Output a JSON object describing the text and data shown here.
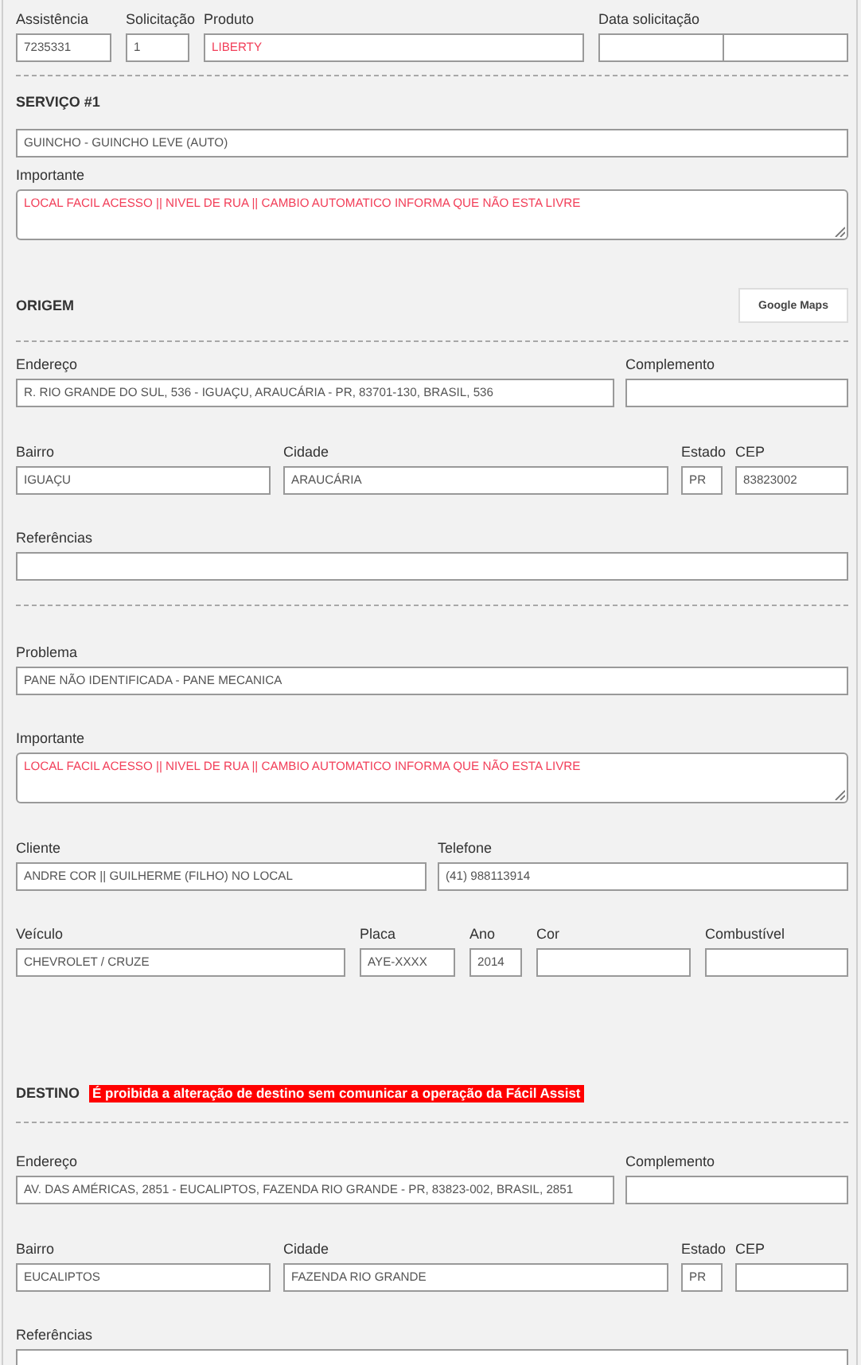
{
  "blocks": [
    {
      "kind": "row",
      "fields": [
        {
          "kind": "text",
          "label": "Assistência",
          "value": "7235331",
          "warning": false
        },
        {
          "kind": "text",
          "label": "Solicitação",
          "value": "1",
          "warning": false
        },
        {
          "kind": "text",
          "label": "Produto",
          "value": "LIBERTY",
          "warning": true
        },
        {
          "kind": "split",
          "label": "Data solicitação"
        }
      ]
    },
    {
      "kind": "divider"
    },
    {
      "kind": "heading",
      "title": "SERVIÇO #1"
    },
    {
      "kind": "row",
      "fields": [
        {
          "kind": "text",
          "value": "GUINCHO - GUINCHO LEVE (AUTO)",
          "warning": false
        }
      ]
    },
    {
      "kind": "row",
      "fields": [
        {
          "kind": "textarea",
          "label": "Importante",
          "value": "LOCAL FACIL ACESSO || NIVEL DE RUA || CAMBIO AUTOMATICO INFORMA QUE NÃO ESTA LIVRE",
          "warning": true
        }
      ]
    },
    {
      "kind": "heading",
      "title": "ORIGEM",
      "button": "Google Maps"
    },
    {
      "kind": "divider"
    },
    {
      "kind": "row",
      "fields": [
        {
          "kind": "text",
          "label": "Endereço",
          "value": "R. RIO GRANDE DO SUL, 536 - IGUAÇU, ARAUCÁRIA - PR, 83701-130, BRASIL, 536",
          "warning": false
        },
        {
          "kind": "text",
          "label": "Complemento"
        }
      ]
    },
    {
      "kind": "row",
      "fields": [
        {
          "kind": "text",
          "label": "Bairro",
          "value": "IGUAÇU",
          "warning": false
        },
        {
          "kind": "text",
          "label": "Cidade",
          "value": "ARAUCÁRIA",
          "warning": false
        },
        {
          "kind": "text",
          "label": "Estado",
          "value": "PR",
          "warning": false
        },
        {
          "kind": "text",
          "label": "CEP",
          "value": "83823002",
          "warning": false
        }
      ]
    },
    {
      "kind": "row",
      "fields": [
        {
          "kind": "text",
          "label": "Referências"
        }
      ]
    },
    {
      "kind": "divider"
    },
    {
      "kind": "row",
      "fields": [
        {
          "kind": "text",
          "label": "Problema",
          "value": "PANE NÃO IDENTIFICADA - PANE MECANICA",
          "warning": false
        }
      ]
    },
    {
      "kind": "row",
      "fields": [
        {
          "kind": "textarea",
          "label": "Importante",
          "value": "LOCAL FACIL ACESSO || NIVEL DE RUA || CAMBIO AUTOMATICO INFORMA QUE NÃO ESTA LIVRE",
          "warning": true
        }
      ]
    },
    {
      "kind": "row",
      "fields": [
        {
          "kind": "text",
          "label": "Cliente",
          "value": "ANDRE COR || GUILHERME (FILHO) NO LOCAL",
          "warning": false
        },
        {
          "kind": "text",
          "label": "Telefone",
          "value": "(41) 988113914",
          "warning": false
        }
      ]
    },
    {
      "kind": "row",
      "fields": [
        {
          "kind": "text",
          "label": "Veículo",
          "value": "CHEVROLET / CRUZE",
          "warning": false
        },
        {
          "kind": "text",
          "label": "Placa",
          "value": "AYE-XXXX",
          "warning": false
        },
        {
          "kind": "text",
          "label": "Ano",
          "value": "2014",
          "warning": false
        },
        {
          "kind": "text",
          "label": "Cor"
        },
        {
          "kind": "text",
          "label": "Combustível"
        }
      ]
    },
    {
      "kind": "heading",
      "title": "DESTINO",
      "notice": "É proibida a alteração de destino sem comunicar a operação da Fácil Assist"
    },
    {
      "kind": "divider"
    },
    {
      "kind": "row",
      "fields": [
        {
          "kind": "text",
          "label": "Endereço",
          "value": "AV. DAS AMÉRICAS, 2851 - EUCALIPTOS, FAZENDA RIO GRANDE - PR, 83823-002, BRASIL, 2851",
          "warning": false
        },
        {
          "kind": "text",
          "label": "Complemento"
        }
      ]
    },
    {
      "kind": "row",
      "fields": [
        {
          "kind": "text",
          "label": "Bairro",
          "value": "EUCALIPTOS",
          "warning": false
        },
        {
          "kind": "text",
          "label": "Cidade",
          "value": "FAZENDA RIO GRANDE",
          "warning": false
        },
        {
          "kind": "text",
          "label": "Estado",
          "value": "PR",
          "warning": false
        },
        {
          "kind": "text",
          "label": "CEP"
        }
      ]
    },
    {
      "kind": "row",
      "fields": [
        {
          "kind": "text",
          "label": "Referências"
        }
      ]
    }
  ]
}
